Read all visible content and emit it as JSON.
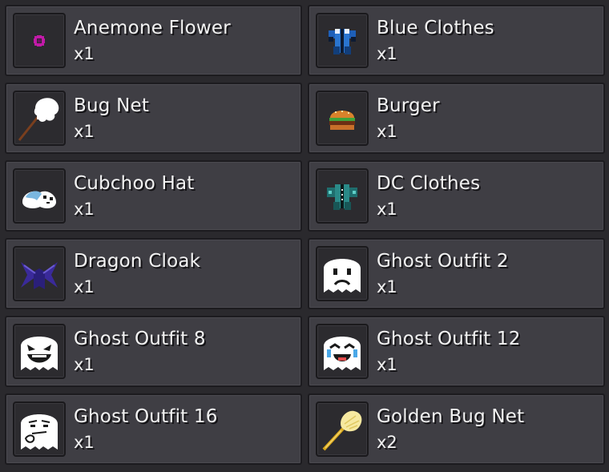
{
  "inventory": {
    "items": [
      {
        "name": "Anemone Flower",
        "qty": "x1",
        "icon": "anemone-flower-icon"
      },
      {
        "name": "Blue Clothes",
        "qty": "x1",
        "icon": "blue-clothes-icon"
      },
      {
        "name": "Bug Net",
        "qty": "x1",
        "icon": "bug-net-icon"
      },
      {
        "name": "Burger",
        "qty": "x1",
        "icon": "burger-icon"
      },
      {
        "name": "Cubchoo Hat",
        "qty": "x1",
        "icon": "cubchoo-hat-icon"
      },
      {
        "name": "DC Clothes",
        "qty": "x1",
        "icon": "dc-clothes-icon"
      },
      {
        "name": "Dragon Cloak",
        "qty": "x1",
        "icon": "dragon-cloak-icon"
      },
      {
        "name": "Ghost Outfit 2",
        "qty": "x1",
        "icon": "ghost-outfit-sad-icon"
      },
      {
        "name": "Ghost Outfit 8",
        "qty": "x1",
        "icon": "ghost-outfit-grin-icon"
      },
      {
        "name": "Ghost Outfit 12",
        "qty": "x1",
        "icon": "ghost-outfit-crying-laugh-icon"
      },
      {
        "name": "Ghost Outfit 16",
        "qty": "x1",
        "icon": "ghost-outfit-smug-icon"
      },
      {
        "name": "Golden Bug Net",
        "qty": "x2",
        "icon": "golden-bug-net-icon"
      }
    ]
  },
  "colors": {
    "background": "#2a292d",
    "card": "#3f3e44",
    "slot": "#2c2b2f",
    "text": "#f2f2f2"
  }
}
